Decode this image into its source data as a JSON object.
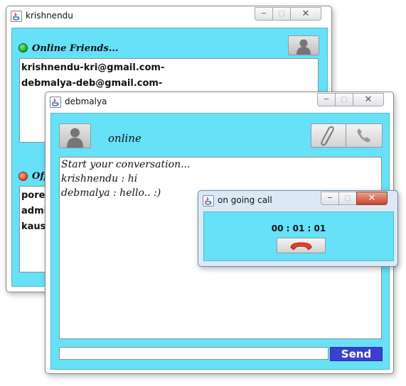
{
  "window_main": {
    "title": "krishnendu",
    "online_label": "Online Friends...",
    "online_friends": [
      "krishnendu-kri@gmail.com-",
      "debmalya-deb@gmail.com-"
    ],
    "offline_label": "Off",
    "offline_friends": [
      "porel",
      "admi",
      "kaus"
    ],
    "status_online_color": "#1fb51f",
    "status_offline_color": "#e8502a"
  },
  "window_chat": {
    "title": "debmalya",
    "status": "online",
    "messages": [
      "Start your conversation...",
      "krishnendu : hi",
      "debmalya : hello.. :)"
    ],
    "input_value": "",
    "send_label": "Send"
  },
  "window_call": {
    "title": "on going call",
    "timer": "00 : 01 : 01"
  },
  "icons": {
    "java": "java-icon",
    "avatar": "user-avatar-icon",
    "attach": "paperclip-icon",
    "call": "phone-icon",
    "hangup": "hang-up-icon"
  },
  "colors": {
    "panel": "#66e1f8",
    "send_button": "#3b3fd0",
    "hangup": "#e0421e"
  }
}
